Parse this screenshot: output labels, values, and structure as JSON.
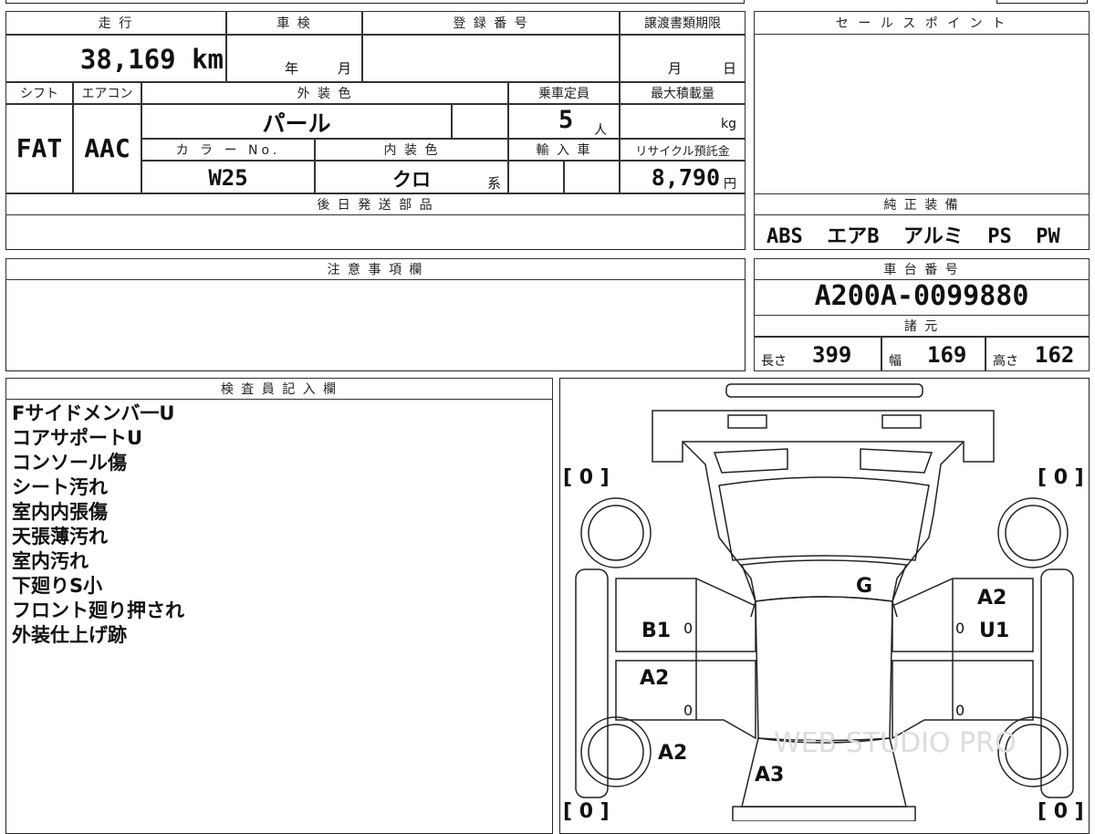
{
  "header": {
    "mileage_label": "走 行",
    "shaken_label": "車 検",
    "reg_label": "登 録 番 号",
    "transfer_label": "譲渡書類期限",
    "sales_label": "セ ー ル ス ポ イ ン ト"
  },
  "mileage": {
    "value": "38,169 km"
  },
  "shaken": {
    "year": "年",
    "month": "月"
  },
  "transfer": {
    "month": "月",
    "day": "日"
  },
  "row2": {
    "shift_label": "シフト",
    "aircon_label": "エアコン",
    "exterior_label": "外 装 色",
    "capacity_label": "乗車定員",
    "load_label": "最大積載量",
    "shift": "FAT",
    "aircon": "AAC",
    "exterior": "パール",
    "capacity": "5",
    "capacity_unit": "人",
    "load_unit": "kg"
  },
  "row3": {
    "color_no_label": "カ ラ ー No.",
    "interior_label": "内 装 色",
    "import_label": "輸 入 車",
    "recycle_label": "リサイクル預託金",
    "color_no": "W25",
    "interior": "クロ",
    "interior_suffix": "系",
    "recycle": "8,790",
    "recycle_unit": "円"
  },
  "later_parts_label": "後 日 発 送 部 品",
  "equipment": {
    "label": "純 正 装 備",
    "value": "ABS  エアB  アルミ  PS  PW"
  },
  "caution_label": "注 意 事 項 欄",
  "chassis": {
    "label": "車 台 番 号",
    "value": "A200A-0099880"
  },
  "specs": {
    "label": "諸 元",
    "length_label": "長さ",
    "length": "399",
    "width_label": "幅",
    "width": "169",
    "height_label": "高さ",
    "height": "162"
  },
  "inspector": {
    "label": "検 査 員 記 入 欄",
    "notes": [
      "Fサイドメンバ一U",
      "コアサポートU",
      "コンソール傷",
      "シート汚れ",
      "室内内張傷",
      "天張薄汚れ",
      "室内汚れ",
      "下廻りS小",
      "フロント廻り押され",
      "外装仕上げ跡"
    ]
  },
  "diagram": {
    "tire_fl": "[ 0 ]",
    "tire_fr": "[ 0 ]",
    "tire_rl": "[ 0 ]",
    "tire_rr": "[ 0 ]",
    "mark_g": "G",
    "mark_b1": "B1",
    "mark_a2_fr": "A2",
    "mark_u1": "U1",
    "mark_a2_rl": "A2",
    "mark_a2_rlw": "A2",
    "mark_a3": "A3",
    "zero1": "0",
    "zero2": "0",
    "zero3": "0",
    "zero4": "0",
    "watermark": "WEB STUDIO PRO"
  }
}
